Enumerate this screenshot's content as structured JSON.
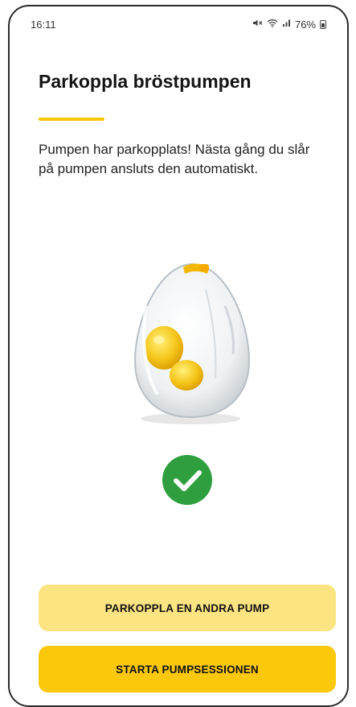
{
  "status_bar": {
    "time": "16:11",
    "mute_icon": "mute-icon",
    "wifi_icon": "wifi-icon",
    "signal_icon": "signal-icon",
    "battery_percent": "76%",
    "battery_icon": "battery-icon"
  },
  "page": {
    "title": "Parkoppla bröstpumpen",
    "message": "Pumpen har parkopplats! Nästa gång du slår på pumpen ansluts den automatiskt."
  },
  "success_icon": "check-circle-icon",
  "actions": {
    "secondary_label": "PARKOPPLA EN ANDRA PUMP",
    "primary_label": "STARTA PUMPSESSIONEN"
  },
  "colors": {
    "accent": "#f7c600",
    "primary_button": "#fbc80c",
    "secondary_button": "#fde482",
    "success": "#2e9e3e"
  }
}
